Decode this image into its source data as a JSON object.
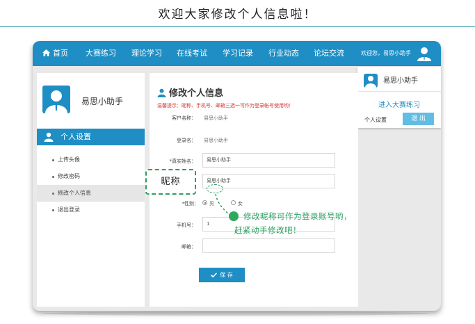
{
  "headline": "欢迎大家修改个人信息啦！",
  "nav": {
    "items": [
      "首页",
      "大赛练习",
      "理论学习",
      "在线考试",
      "学习记录",
      "行业动态",
      "论坛交流"
    ],
    "welcome": "欢迎您，易思小助手"
  },
  "dropdown": {
    "name": "易思小助手",
    "link": "进入大赛练习",
    "settings": "个人设置",
    "logout": "退 出"
  },
  "sidebar": {
    "name": "易思小助手",
    "section": "个人设置",
    "items": [
      "上传头像",
      "修改密码",
      "修改个人信息",
      "退出登录"
    ],
    "active_index": 2
  },
  "form": {
    "title": "修改个人信息",
    "tip": "温馨提示：昵称、手机号、邮箱三选一可作为登录帐号使用哟！",
    "customer_label": "客户名称：",
    "customer_value": "易思小助手",
    "login_label": "登录名：",
    "login_value": "易思小助手",
    "realname_label": "*真实姓名：",
    "realname_value": "易思小助手",
    "nickname_value": "易思小助手",
    "gender_label": "*性别：",
    "gender_male": "男",
    "gender_female": "女",
    "phone_label": "手机号：",
    "phone_value": "1",
    "email_label": "邮箱：",
    "email_value": "",
    "save": "保 存"
  },
  "annotation": {
    "callout": "昵称",
    "line1": "修改昵称可作为登录账号哟，",
    "line2": "赶紧动手修改吧！"
  },
  "colors": {
    "brand": "#1e8ec4",
    "tip": "#d9312e",
    "annotation": "#2f9e63"
  }
}
